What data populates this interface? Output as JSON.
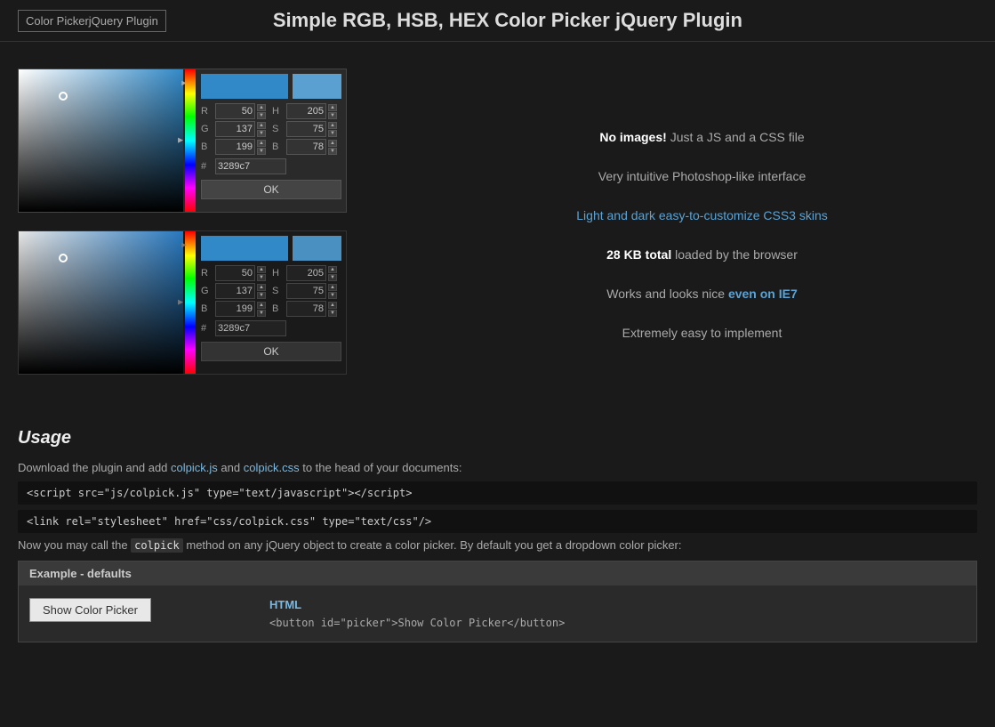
{
  "header": {
    "logo_text": "Color PickerjQuery Plugin",
    "title": "Simple RGB, HSB, HEX Color Picker jQuery Plugin"
  },
  "features": [
    {
      "id": "f1",
      "text": "No images!",
      "suffix": " Just a JS and a CSS file",
      "style": "highlight"
    },
    {
      "id": "f2",
      "text": "Very intuitive Photoshop-like interface",
      "style": "normal"
    },
    {
      "id": "f3",
      "text": "Light and dark easy-to-customize CSS3 skins",
      "style": "blue"
    },
    {
      "id": "f4",
      "text": "28 KB total",
      "suffix": " loaded by the browser",
      "style": "highlight"
    },
    {
      "id": "f5",
      "text": "Works and looks nice ",
      "emphasis": "even on IE7",
      "style": "mixed"
    },
    {
      "id": "f6",
      "text": "Extremely easy to implement",
      "style": "normal"
    }
  ],
  "picker_light": {
    "r": "50",
    "g": "137",
    "b": "199",
    "h": "205",
    "s": "75",
    "b2": "78",
    "hex": "3289c7",
    "ok_label": "OK"
  },
  "picker_dark": {
    "r": "50",
    "g": "137",
    "b": "199",
    "h": "205",
    "s": "75",
    "b2": "78",
    "hex": "3289c7",
    "ok_label": "OK"
  },
  "usage": {
    "title": "Usage",
    "intro": "Download the plugin and add colpick.js and colpick.css to the head of your documents:",
    "colpick_js": "colpick.js",
    "colpick_css": "colpick.css",
    "script_tag": "<script src=\"js/colpick.js\" type=\"text/javascript\"></script>",
    "link_tag": "<link rel=\"stylesheet\" href=\"css/colpick.css\" type=\"text/css\"/>",
    "method_text_before": "Now you may call the ",
    "method_name": "colpick",
    "method_text_after": " method on any jQuery object to create a color picker. By default you get a dropdown color picker:",
    "example_title": "Example - defaults",
    "show_picker_label": "Show Color Picker",
    "html_label": "HTML",
    "html_code": "<button id=\"picker\">Show Color Picker</button>"
  }
}
